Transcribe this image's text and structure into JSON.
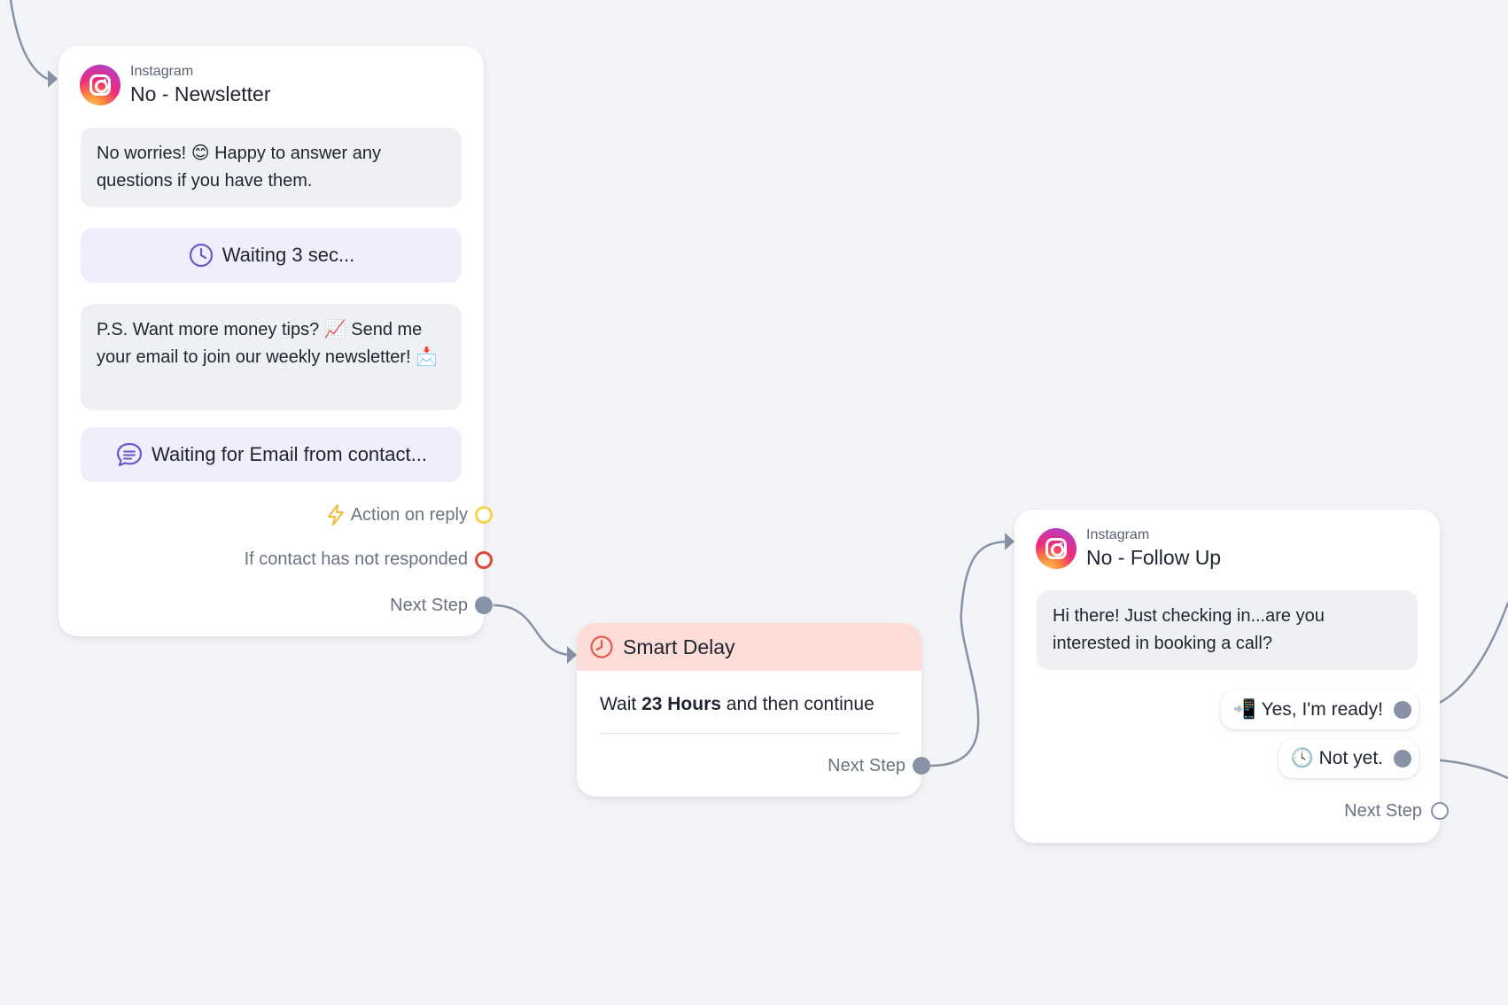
{
  "colors": {
    "canvas_bg": "#f3f4f7",
    "wire": "#8892a6",
    "wait_bg": "#f0edfd",
    "wait_icon": "#6e58c9",
    "delay_header_bg": "#fdddd7",
    "delay_icon": "#e15b4e",
    "action_reply": "#f8d24f",
    "not_responded": "#e0473c"
  },
  "newsletter_node": {
    "channel": "Instagram",
    "title": "No - Newsletter",
    "icon": "instagram-logo",
    "message_1": "No worries! 😊 Happy to answer any questions if you have them.",
    "wait_1": {
      "icon": "clock-icon",
      "label": "Waiting 3 sec..."
    },
    "message_2": "P.S. Want more money tips? 📈 Send me your email to join our weekly newsletter! 📩",
    "wait_2": {
      "icon": "chat-bubble-icon",
      "label": "Waiting for Email from contact..."
    },
    "outputs": {
      "action_on_reply": {
        "icon": "lightning-icon",
        "label": "Action on reply"
      },
      "not_responded": {
        "label": "If contact has not responded"
      },
      "next_step": {
        "label": "Next Step"
      }
    }
  },
  "smart_delay_node": {
    "icon": "clock-icon",
    "title": "Smart Delay",
    "body_prefix": "Wait",
    "duration": "23 Hours",
    "body_suffix": "and then continue",
    "next_step": "Next Step"
  },
  "follow_up_node": {
    "channel": "Instagram",
    "title": "No - Follow Up",
    "icon": "instagram-logo",
    "message": "Hi there! Just checking in...are you interested in booking a call?",
    "quick_replies": [
      {
        "label": "📲 Yes, I'm ready!"
      },
      {
        "label": "🕓 Not yet."
      }
    ],
    "next_step": "Next Step"
  }
}
